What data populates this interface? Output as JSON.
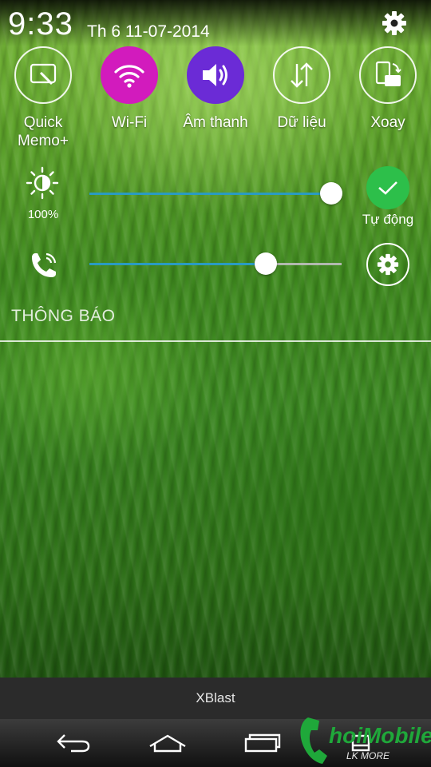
{
  "status_bar": {
    "time": "9:33",
    "date": "Th 6 11-07-2014",
    "settings_icon": "gear-icon"
  },
  "quick_toggles": [
    {
      "label": "Quick Memo+",
      "icon": "quick-memo-icon",
      "state": "off"
    },
    {
      "label": "Wi-Fi",
      "icon": "wifi-icon",
      "state": "on",
      "color": "#d21bbd"
    },
    {
      "label": "Âm thanh",
      "icon": "volume-icon",
      "state": "on",
      "color": "#6b2bd6"
    },
    {
      "label": "Dữ liệu",
      "icon": "data-transfer-icon",
      "state": "off"
    },
    {
      "label": "Xoay",
      "icon": "rotate-icon",
      "state": "off"
    }
  ],
  "brightness": {
    "percent_label": "100%",
    "level": 0.96,
    "auto_label": "Tự động",
    "auto_enabled": true
  },
  "ringer": {
    "level": 0.7
  },
  "notifications": {
    "title": "THÔNG BÁO"
  },
  "app_bar": {
    "title": "XBlast"
  },
  "nav_bar": {
    "buttons": [
      "back-icon",
      "home-icon",
      "recent-apps-icon",
      "menu-icon"
    ]
  },
  "watermark": {
    "text": "hoiMobile",
    "tagline": "LK MORE"
  },
  "colors": {
    "slider_fill": "#2a9bc2",
    "auto_green": "#2dbf4a",
    "wifi_magenta": "#d21bbd",
    "sound_purple": "#6b2bd6"
  }
}
